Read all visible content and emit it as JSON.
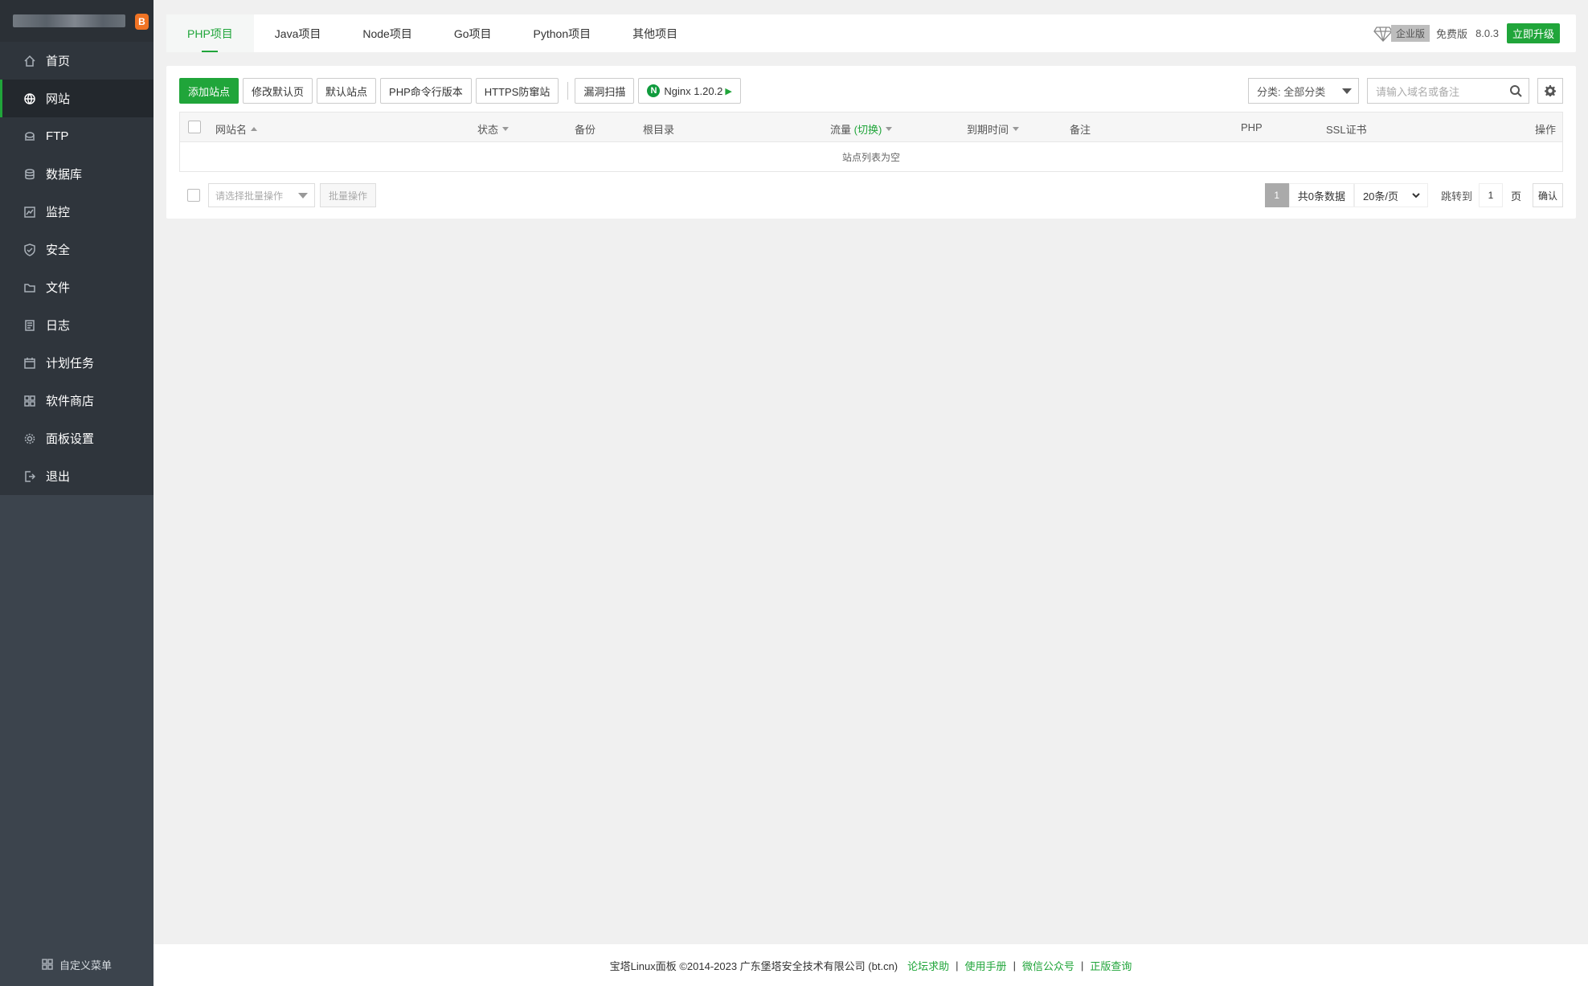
{
  "brand": {
    "badge": "B"
  },
  "sidebar": {
    "items": [
      {
        "label": "首页",
        "icon": "home-icon"
      },
      {
        "label": "网站",
        "icon": "globe-icon"
      },
      {
        "label": "FTP",
        "icon": "ftp-icon"
      },
      {
        "label": "数据库",
        "icon": "database-icon"
      },
      {
        "label": "监控",
        "icon": "monitor-icon"
      },
      {
        "label": "安全",
        "icon": "shield-icon"
      },
      {
        "label": "文件",
        "icon": "folder-icon"
      },
      {
        "label": "日志",
        "icon": "log-icon"
      },
      {
        "label": "计划任务",
        "icon": "calendar-icon"
      },
      {
        "label": "软件商店",
        "icon": "apps-icon"
      },
      {
        "label": "面板设置",
        "icon": "settings-icon"
      },
      {
        "label": "退出",
        "icon": "logout-icon"
      }
    ],
    "active_index": 1,
    "custom_menu": "自定义菜单"
  },
  "tabs": [
    {
      "label": "PHP项目"
    },
    {
      "label": "Java项目"
    },
    {
      "label": "Node项目"
    },
    {
      "label": "Go项目"
    },
    {
      "label": "Python项目"
    },
    {
      "label": "其他项目"
    }
  ],
  "header": {
    "enterprise": "企业版",
    "free": "免费版",
    "version": "8.0.3",
    "upgrade": "立即升级"
  },
  "toolbar": {
    "add_site": "添加站点",
    "modify_default_page": "修改默认页",
    "default_site": "默认站点",
    "php_cli_version": "PHP命令行版本",
    "https_guard": "HTTPS防窜站",
    "vuln_scan": "漏洞扫描",
    "nginx": "Nginx 1.20.2",
    "nginx_logo": "N"
  },
  "filters": {
    "category": "分类: 全部分类",
    "search_placeholder": "请输入域名或备注"
  },
  "table": {
    "headers": {
      "site_name": "网站名",
      "status": "状态",
      "backup": "备份",
      "root": "根目录",
      "traffic": "流量",
      "traffic_toggle": "(切换)",
      "expiry": "到期时间",
      "remark": "备注",
      "php": "PHP",
      "ssl": "SSL证书",
      "actions": "操作"
    },
    "empty_text": "站点列表为空"
  },
  "batch": {
    "select_placeholder": "请选择批量操作",
    "button": "批量操作"
  },
  "pager": {
    "current": "1",
    "total": "共0条数据",
    "page_size": "20条/页",
    "goto": "跳转到",
    "input_value": "1",
    "unit": "页",
    "confirm": "确认"
  },
  "footer": {
    "copyright": "宝塔Linux面板 ©2014-2023 广东堡塔安全技术有限公司 (bt.cn)",
    "links": [
      "论坛求助",
      "使用手册",
      "微信公众号",
      "正版查询"
    ]
  },
  "colors": {
    "accent": "#20a53a",
    "sidebar_bg": "#3c444d",
    "sidebar_menu_bg": "#2f353c",
    "sidebar_active_bg": "#23282d"
  }
}
